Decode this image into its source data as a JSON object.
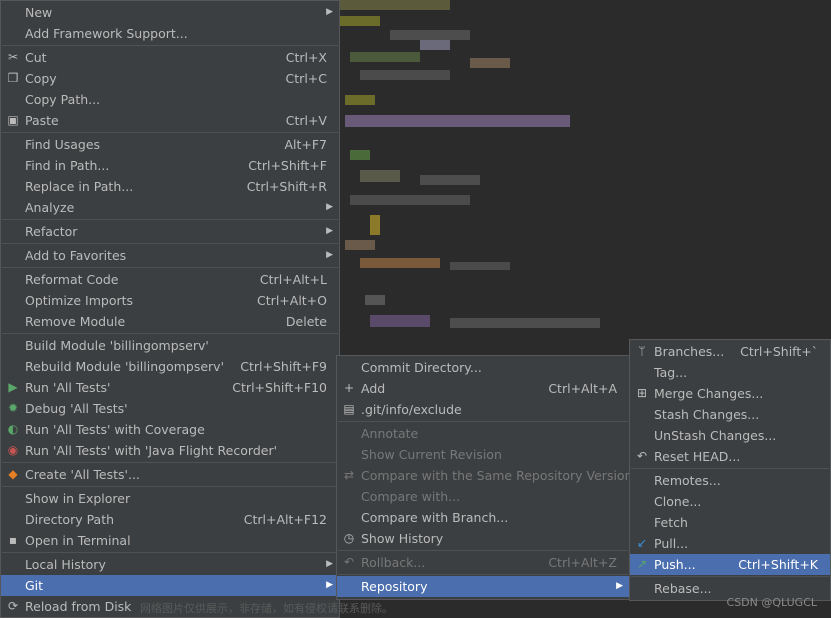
{
  "main_menu": [
    {
      "label": "New",
      "icon": "",
      "shortcut": "",
      "arrow": true
    },
    {
      "label": "Add Framework Support...",
      "icon": "",
      "shortcut": ""
    },
    {
      "sep": true
    },
    {
      "label": "Cut",
      "icon": "scissors-icon",
      "glyph": "✂",
      "shortcut": "Ctrl+X"
    },
    {
      "label": "Copy",
      "icon": "copy-icon",
      "glyph": "❐",
      "shortcut": "Ctrl+C"
    },
    {
      "label": "Copy Path...",
      "icon": "",
      "shortcut": ""
    },
    {
      "label": "Paste",
      "icon": "paste-icon",
      "glyph": "▣",
      "shortcut": "Ctrl+V"
    },
    {
      "sep": true
    },
    {
      "label": "Find Usages",
      "icon": "",
      "shortcut": "Alt+F7"
    },
    {
      "label": "Find in Path...",
      "icon": "",
      "shortcut": "Ctrl+Shift+F"
    },
    {
      "label": "Replace in Path...",
      "icon": "",
      "shortcut": "Ctrl+Shift+R"
    },
    {
      "label": "Analyze",
      "icon": "",
      "shortcut": "",
      "arrow": true
    },
    {
      "sep": true
    },
    {
      "label": "Refactor",
      "icon": "",
      "shortcut": "",
      "arrow": true
    },
    {
      "sep": true
    },
    {
      "label": "Add to Favorites",
      "icon": "",
      "shortcut": "",
      "arrow": true
    },
    {
      "sep": true
    },
    {
      "label": "Reformat Code",
      "icon": "",
      "shortcut": "Ctrl+Alt+L"
    },
    {
      "label": "Optimize Imports",
      "icon": "",
      "shortcut": "Ctrl+Alt+O"
    },
    {
      "label": "Remove Module",
      "icon": "",
      "shortcut": "Delete"
    },
    {
      "sep": true
    },
    {
      "label": "Build Module 'billingompserv'",
      "icon": "",
      "shortcut": ""
    },
    {
      "label": "Rebuild Module 'billingompserv'",
      "icon": "",
      "shortcut": "Ctrl+Shift+F9"
    },
    {
      "label": "Run 'All Tests'",
      "icon": "run-icon",
      "glyph": "▶",
      "color": "#59a869",
      "shortcut": "Ctrl+Shift+F10"
    },
    {
      "label": "Debug 'All Tests'",
      "icon": "debug-icon",
      "glyph": "✹",
      "color": "#59a869",
      "shortcut": ""
    },
    {
      "label": "Run 'All Tests' with Coverage",
      "icon": "coverage-icon",
      "glyph": "◐",
      "color": "#59a869",
      "shortcut": ""
    },
    {
      "label": "Run 'All Tests' with 'Java Flight Recorder'",
      "icon": "profiler-icon",
      "glyph": "◉",
      "color": "#c75450",
      "shortcut": ""
    },
    {
      "sep": true
    },
    {
      "label": "Create 'All Tests'...",
      "icon": "create-config-icon",
      "glyph": "◆",
      "color": "#e67e22",
      "shortcut": ""
    },
    {
      "sep": true
    },
    {
      "label": "Show in Explorer",
      "icon": "",
      "shortcut": ""
    },
    {
      "label": "Directory Path",
      "icon": "",
      "shortcut": "Ctrl+Alt+F12"
    },
    {
      "label": "Open in Terminal",
      "icon": "terminal-icon",
      "glyph": "▪",
      "shortcut": ""
    },
    {
      "sep": true
    },
    {
      "label": "Local History",
      "icon": "",
      "shortcut": "",
      "arrow": true
    },
    {
      "label": "Git",
      "icon": "",
      "shortcut": "",
      "arrow": true,
      "selected": true
    },
    {
      "label": "Reload from Disk",
      "icon": "reload-icon",
      "glyph": "⟳",
      "shortcut": ""
    }
  ],
  "git_menu": [
    {
      "label": "Commit Directory...",
      "icon": "",
      "shortcut": ""
    },
    {
      "label": "Add",
      "icon": "plus-icon",
      "glyph": "+",
      "shortcut": "Ctrl+Alt+A"
    },
    {
      "label": ".git/info/exclude",
      "icon": "git-file-icon",
      "glyph": "▤",
      "shortcut": ""
    },
    {
      "sep": true
    },
    {
      "label": "Annotate",
      "icon": "",
      "shortcut": "",
      "disabled": true
    },
    {
      "label": "Show Current Revision",
      "icon": "",
      "shortcut": "",
      "disabled": true
    },
    {
      "label": "Compare with the Same Repository Version",
      "icon": "compare-icon",
      "glyph": "⇄",
      "shortcut": "",
      "disabled": true
    },
    {
      "label": "Compare with...",
      "icon": "",
      "shortcut": "",
      "disabled": true
    },
    {
      "label": "Compare with Branch...",
      "icon": "",
      "shortcut": ""
    },
    {
      "label": "Show History",
      "icon": "history-icon",
      "glyph": "◷",
      "shortcut": ""
    },
    {
      "sep": true
    },
    {
      "label": "Rollback...",
      "icon": "rollback-icon",
      "glyph": "↶",
      "shortcut": "Ctrl+Alt+Z",
      "disabled": true
    },
    {
      "sep": true
    },
    {
      "label": "Repository",
      "icon": "",
      "shortcut": "",
      "arrow": true,
      "selected": true
    }
  ],
  "repo_menu": [
    {
      "label": "Branches...",
      "icon": "branch-icon",
      "glyph": "ᛘ",
      "shortcut": "Ctrl+Shift+`"
    },
    {
      "label": "Tag...",
      "icon": "",
      "shortcut": ""
    },
    {
      "label": "Merge Changes...",
      "icon": "merge-icon",
      "glyph": "⊞",
      "shortcut": ""
    },
    {
      "label": "Stash Changes...",
      "icon": "",
      "shortcut": ""
    },
    {
      "label": "UnStash Changes...",
      "icon": "",
      "shortcut": ""
    },
    {
      "label": "Reset HEAD...",
      "icon": "reset-icon",
      "glyph": "↶",
      "shortcut": ""
    },
    {
      "sep": true
    },
    {
      "label": "Remotes...",
      "icon": "",
      "shortcut": ""
    },
    {
      "label": "Clone...",
      "icon": "",
      "shortcut": ""
    },
    {
      "label": "Fetch",
      "icon": "",
      "shortcut": ""
    },
    {
      "label": "Pull...",
      "icon": "pull-icon",
      "glyph": "↙",
      "color": "#3d8fd6",
      "shortcut": ""
    },
    {
      "label": "Push...",
      "icon": "push-icon",
      "glyph": "↗",
      "color": "#59a869",
      "shortcut": "Ctrl+Shift+K",
      "selected": true
    },
    {
      "sep": true
    },
    {
      "label": "Rebase...",
      "icon": "",
      "shortcut": ""
    }
  ],
  "watermark": "网络图片仅供展示，非存储，如有侵权请联系删除。",
  "credit": "CSDN @QLUGCL"
}
